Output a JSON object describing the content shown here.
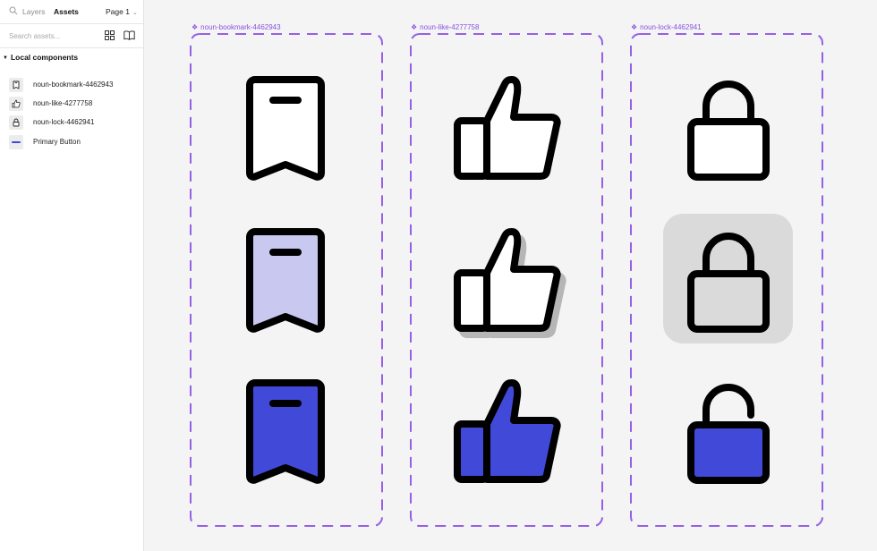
{
  "panel": {
    "tabs": {
      "layers": "Layers",
      "assets": "Assets"
    },
    "page_label": "Page 1",
    "search": {
      "placeholder": "Search assets...",
      "value": ""
    },
    "section_title": "Local components",
    "components": [
      {
        "label": "noun-bookmark-4462943",
        "icon": "bookmark-icon"
      },
      {
        "label": "noun-like-4277758",
        "icon": "thumbs-up-icon"
      },
      {
        "label": "noun-lock-4462941",
        "icon": "lock-icon"
      },
      {
        "label": "Primary Button",
        "icon": "button-line-icon"
      }
    ]
  },
  "canvas": {
    "frames": [
      {
        "title": "noun-bookmark-4462943",
        "icon": "bookmark-icon",
        "states": [
          "default",
          "hover",
          "active"
        ]
      },
      {
        "title": "noun-like-4277758",
        "icon": "thumbs-up-icon",
        "states": [
          "default",
          "hover",
          "active"
        ]
      },
      {
        "title": "noun-lock-4462941",
        "icon": "lock-icon",
        "states": [
          "default",
          "hover",
          "active"
        ]
      }
    ],
    "frame_marker": "❖"
  },
  "colors": {
    "frame_dash": "#9461e6",
    "frame_title": "#8a52e0",
    "light_fill": "#c9c8f0",
    "active_fill": "#4149d8",
    "hover_bg": "#dadada",
    "stroke": "#000000"
  }
}
